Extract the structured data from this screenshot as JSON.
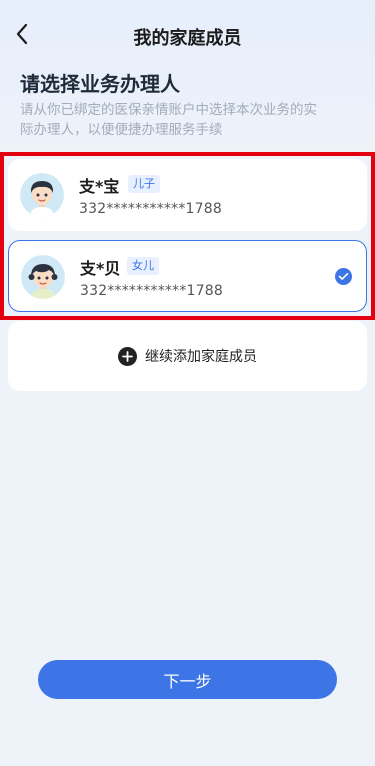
{
  "header": {
    "title": "我的家庭成员",
    "back_icon": "chevron-left-icon"
  },
  "intro": {
    "heading": "请选择业务办理人",
    "description": "请从你已绑定的医保亲情账户中选择本次业务的实际办理人，以便便捷办理服务手续"
  },
  "members": [
    {
      "name": "支*宝",
      "relation": "儿子",
      "id_masked": "332***********1788",
      "selected": false,
      "avatar_icon": "boy-avatar-icon"
    },
    {
      "name": "支*贝",
      "relation": "女儿",
      "id_masked": "332***********1788",
      "selected": true,
      "avatar_icon": "girl-avatar-icon"
    }
  ],
  "add_member": {
    "label": "继续添加家庭成员",
    "icon": "plus-circle-icon"
  },
  "footer": {
    "next_label": "下一步"
  },
  "colors": {
    "accent": "#3d74e6",
    "highlight_frame": "#e3000f",
    "background": "#eef2f9"
  }
}
